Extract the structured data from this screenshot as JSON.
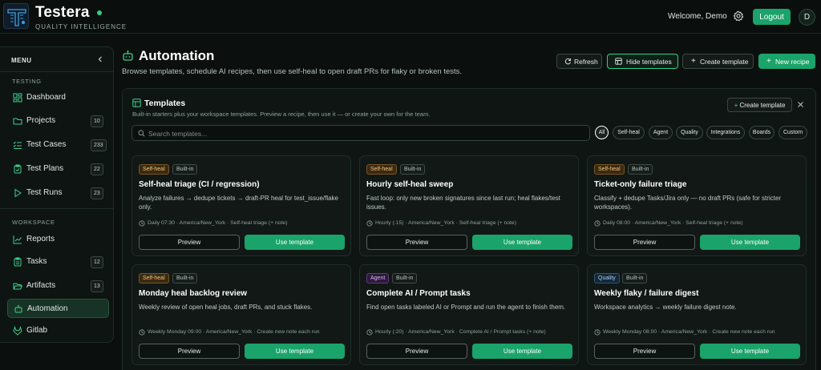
{
  "header": {
    "brand": "Testera",
    "tagline": "QUALITY INTELLIGENCE",
    "welcome": "Welcome, Demo",
    "logout_label": "Logout",
    "avatar_initial": "D"
  },
  "sidebar": {
    "menu_label": "MENU",
    "testing_label": "TESTING",
    "workspace_label": "WORKSPACE",
    "items": [
      {
        "label": "Dashboard",
        "badge": "",
        "icon": "dashboard-icon"
      },
      {
        "label": "Projects",
        "badge": "10",
        "icon": "folder-icon"
      },
      {
        "label": "Test Cases",
        "badge": "233",
        "icon": "checklist-icon"
      },
      {
        "label": "Test Plans",
        "badge": "22",
        "icon": "clipboard-icon"
      },
      {
        "label": "Test Runs",
        "badge": "23",
        "icon": "play-icon"
      },
      {
        "label": "Reports",
        "badge": "",
        "icon": "chart-icon"
      },
      {
        "label": "Tasks",
        "badge": "12",
        "icon": "clipboard-icon"
      },
      {
        "label": "Artifacts",
        "badge": "13",
        "icon": "folder-open-icon"
      },
      {
        "label": "Automation",
        "badge": "",
        "icon": "robot-icon"
      },
      {
        "label": "Gitlab",
        "badge": "",
        "icon": "gitlab-icon"
      }
    ]
  },
  "page": {
    "title": "Automation",
    "subtitle": "Browse templates, schedule AI recipes, then use self-heal to open draft PRs for flaky or broken tests."
  },
  "toolbar": {
    "refresh": "Refresh",
    "hide_templates": "Hide templates",
    "create_template": "Create template",
    "new_recipe": "New recipe"
  },
  "templates": {
    "title": "Templates",
    "subtitle": "Built-in starters plus your workspace templates. Preview a recipe, then use it — or create your own for the team.",
    "create_label": "Create template",
    "search_placeholder": "Search templates...",
    "filters": [
      "All",
      "Self-heal",
      "Agent",
      "Quality",
      "Integrations",
      "Boards",
      "Custom"
    ],
    "preview_label": "Preview",
    "use_label": "Use template",
    "cards": [
      {
        "tag": "Self-heal",
        "tag_kind": "selfheal",
        "builtin": "Built-in",
        "title": "Self-heal triage (CI / regression)",
        "desc": "Analyze failures → dedupe tickets → draft-PR heal for test_issue/flake only.",
        "meta": "Daily 07:30 · America/New_York · Self-heal triage (+ note)"
      },
      {
        "tag": "Self-heal",
        "tag_kind": "selfheal",
        "builtin": "Built-in",
        "title": "Hourly self-heal sweep",
        "desc": "Fast loop: only new broken signatures since last run; heal flakes/test issues.",
        "meta": "Hourly (:15) · America/New_York · Self-heal triage (+ note)"
      },
      {
        "tag": "Self-heal",
        "tag_kind": "selfheal",
        "builtin": "Built-in",
        "title": "Ticket-only failure triage",
        "desc": "Classify + dedupe Tasks/Jira only — no draft PRs (safe for stricter workspaces).",
        "meta": "Daily 08:00 · America/New_York · Self-heal triage (+ note)"
      },
      {
        "tag": "Self-heal",
        "tag_kind": "selfheal",
        "builtin": "Built-in",
        "title": "Monday heal backlog review",
        "desc": "Weekly review of open heal jobs, draft PRs, and stuck flakes.",
        "meta": "Weekly Monday 09:00 · America/New_York · Create new note each run"
      },
      {
        "tag": "Agent",
        "tag_kind": "agent",
        "builtin": "Built-in",
        "title": "Complete AI / Prompt tasks",
        "desc": "Find open tasks labeled AI or Prompt and run the agent to finish them.",
        "meta": "Hourly (:20) · America/New_York · Complete AI / Prompt tasks (+ note)"
      },
      {
        "tag": "Quality",
        "tag_kind": "quality",
        "builtin": "Built-in",
        "title": "Weekly flaky / failure digest",
        "desc": "Workspace analytics → weekly failure digest note.",
        "meta": "Weekly Monday 08:00 · America/New_York · Create new note each run"
      }
    ]
  },
  "colors": {
    "accent": "#1aa36a",
    "background": "#0b100e",
    "selfheal_tag": "#f0c57a",
    "agent_tag": "#d6b3f0",
    "quality_tag": "#a9cdeb"
  }
}
